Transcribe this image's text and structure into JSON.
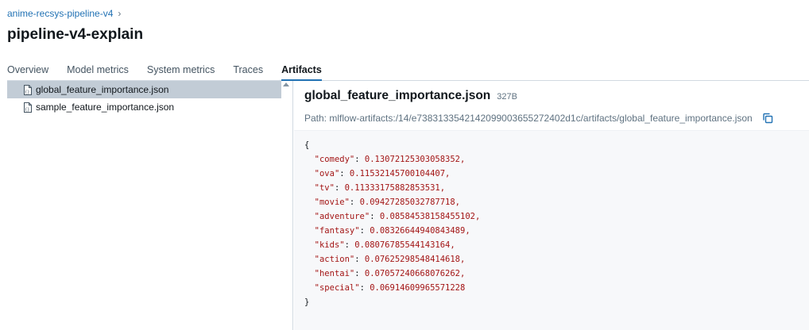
{
  "breadcrumb": {
    "experiment": "anime-recsys-pipeline-v4",
    "separator": "›"
  },
  "run": {
    "title": "pipeline-v4-explain"
  },
  "tabs": [
    {
      "label": "Overview"
    },
    {
      "label": "Model metrics"
    },
    {
      "label": "System metrics"
    },
    {
      "label": "Traces"
    },
    {
      "label": "Artifacts",
      "active": true
    }
  ],
  "files": [
    {
      "name": "global_feature_importance.json",
      "selected": true
    },
    {
      "name": "sample_feature_importance.json",
      "selected": false
    }
  ],
  "artifact": {
    "name": "global_feature_importance.json",
    "size": "327B",
    "path": "Path: mlflow-artifacts:/14/e7383133542142099003655272402d1c/artifacts/global_feature_importance.json"
  },
  "json_content": {
    "open": "{",
    "close": "}",
    "entries": [
      {
        "key": "\"comedy\"",
        "value": "0.13072125303058352,"
      },
      {
        "key": "\"ova\"",
        "value": "0.11532145700104407,"
      },
      {
        "key": "\"tv\"",
        "value": "0.11333175882853531,"
      },
      {
        "key": "\"movie\"",
        "value": "0.09427285032787718,"
      },
      {
        "key": "\"adventure\"",
        "value": "0.08584538158455102,"
      },
      {
        "key": "\"fantasy\"",
        "value": "0.08326644940843489,"
      },
      {
        "key": "\"kids\"",
        "value": "0.08076785544143164,"
      },
      {
        "key": "\"action\"",
        "value": "0.07625298548414618,"
      },
      {
        "key": "\"hentai\"",
        "value": "0.07057240668076262,"
      },
      {
        "key": "\"special\"",
        "value": "0.06914609965571228"
      }
    ]
  },
  "icons": {
    "file": "json-file-icon",
    "copy": "copy-icon"
  },
  "colors": {
    "link": "#2272b4",
    "selected_row": "#c2ccd6",
    "json_value": "#a31515"
  }
}
